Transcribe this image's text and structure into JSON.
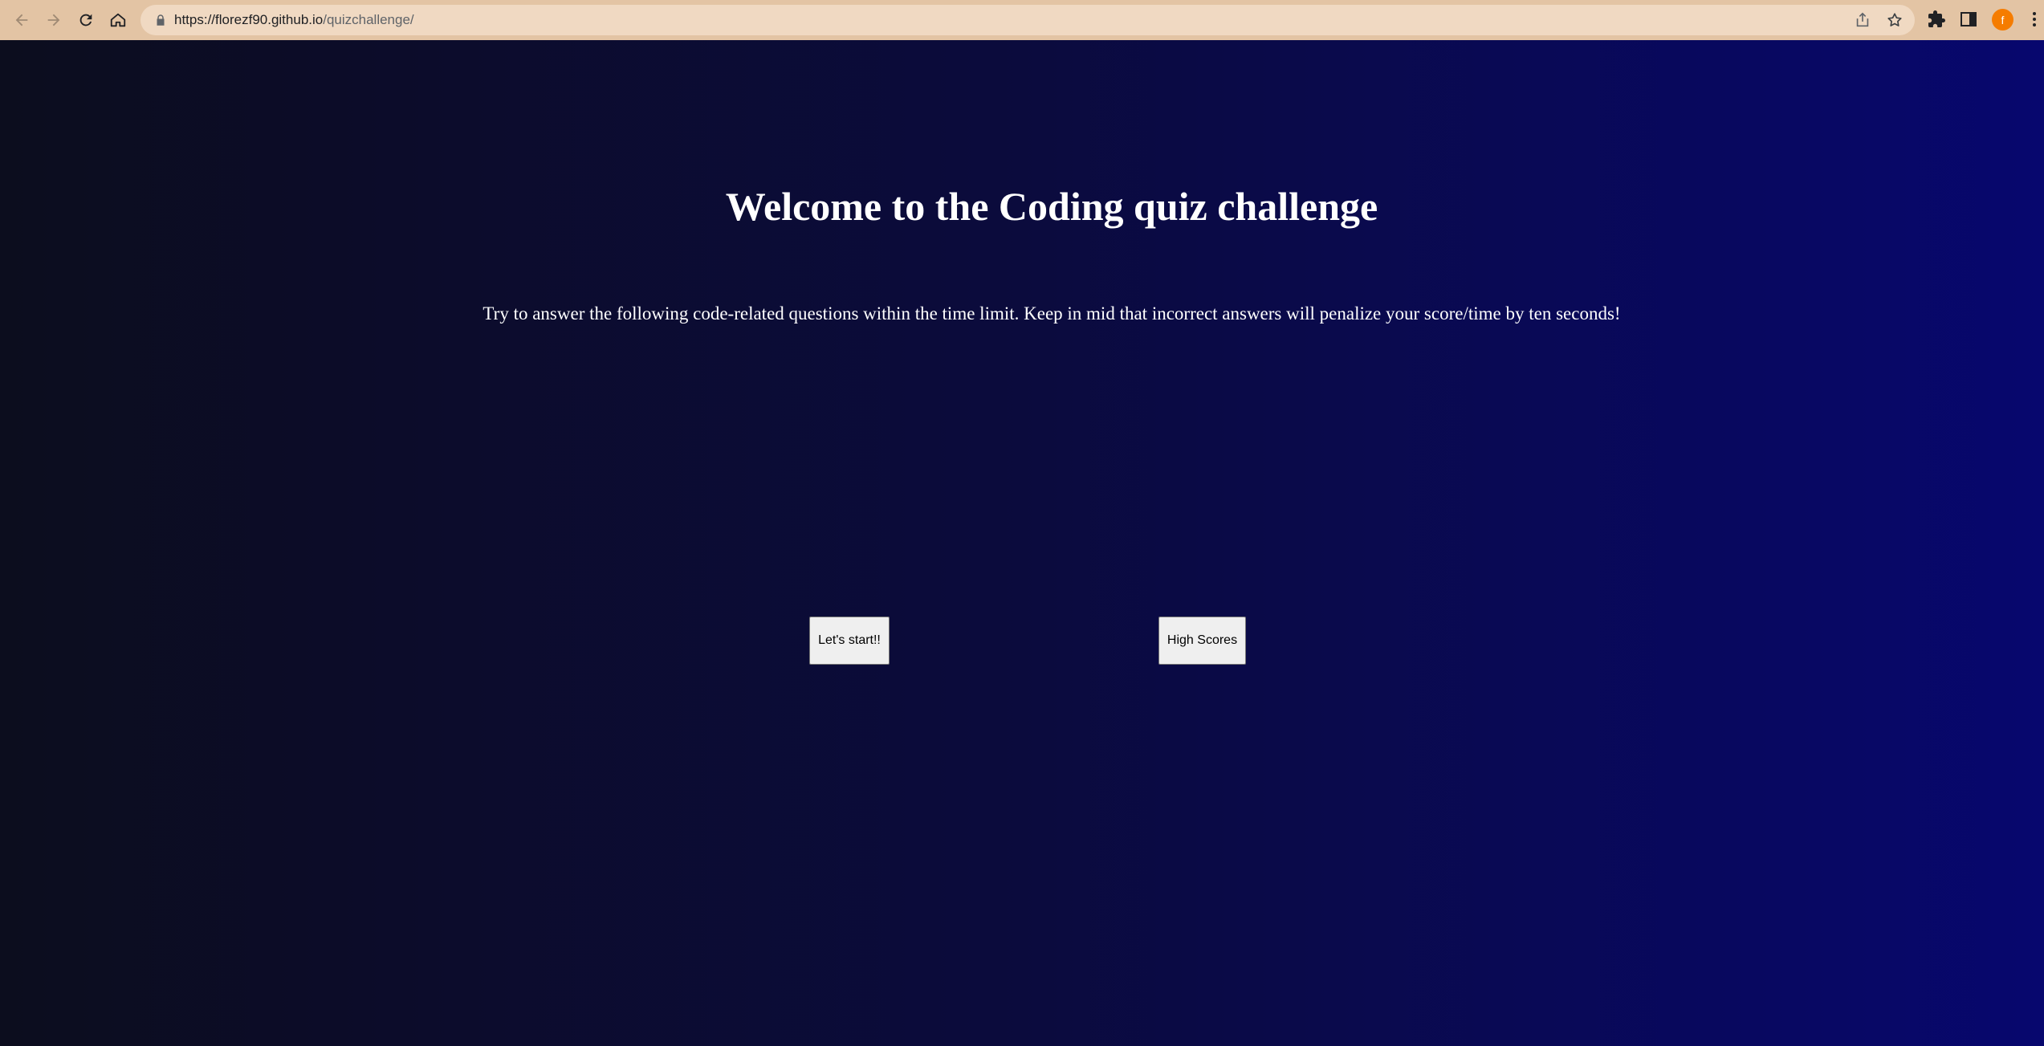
{
  "browser": {
    "url_host": "https://florezf90.github.io",
    "url_path": "/quizchallenge/",
    "avatar_letter": "f",
    "icons": [
      "back-icon",
      "forward-icon",
      "reload-icon",
      "home-icon",
      "lock-icon",
      "share-icon",
      "star-icon",
      "extensions-icon",
      "side-panel-icon",
      "menu-icon"
    ],
    "colors": {
      "toolbar": "#e3c4a4",
      "omnibox": "#f0d9c2",
      "avatar": "#f57c00"
    }
  },
  "page": {
    "title": "Welcome to the Coding quiz challenge",
    "intro": "Try to answer the following code-related questions within the time limit. Keep in mid that incorrect answers will penalize your score/time by ten seconds!",
    "start_button": "Let's start!!",
    "scores_button": "High Scores",
    "colors": {
      "background_left": "#0c0d1e",
      "background_right": "#07076e",
      "text": "#ffffff"
    }
  }
}
